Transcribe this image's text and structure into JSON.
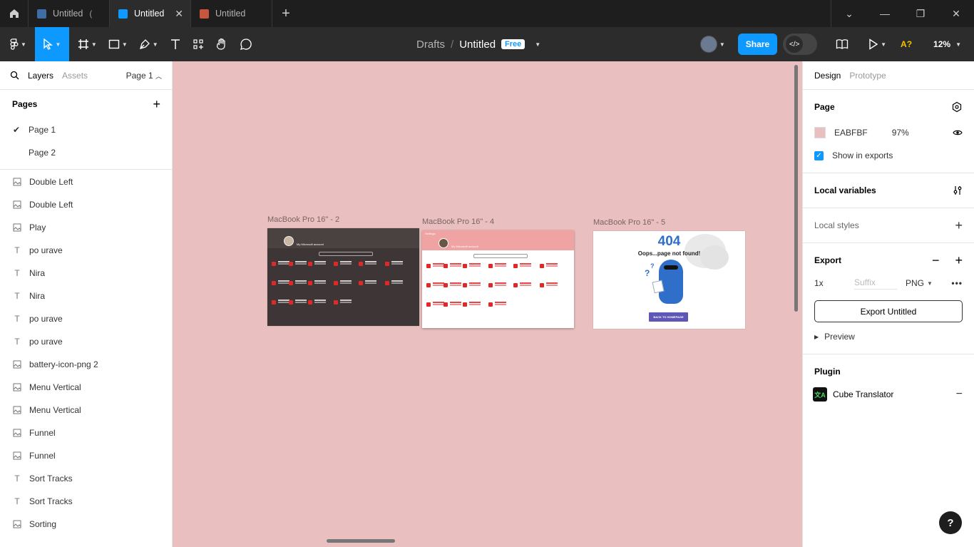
{
  "tabs": [
    {
      "label": "Untitled",
      "active": false,
      "icon_color": "#3d6fa6"
    },
    {
      "label": "Untitled",
      "active": true,
      "icon_color": "#0d99ff"
    },
    {
      "label": "Untitled",
      "active": false,
      "icon_color": "#c8553d"
    }
  ],
  "toolbar": {
    "breadcrumb_drafts": "Drafts",
    "breadcrumb_sep": "/",
    "file_name": "Untitled",
    "plan_badge": "Free",
    "share_label": "Share",
    "font_check": "A?",
    "zoom": "12%"
  },
  "left_panel": {
    "tab_layers": "Layers",
    "tab_assets": "Assets",
    "page_selector": "Page 1",
    "pages_title": "Pages",
    "pages": [
      {
        "label": "Page 1",
        "current": true
      },
      {
        "label": "Page 2",
        "current": false
      }
    ],
    "layers": [
      {
        "label": "Double Left",
        "kind": "image"
      },
      {
        "label": "Double Left",
        "kind": "image"
      },
      {
        "label": "Play",
        "kind": "image"
      },
      {
        "label": "po urave",
        "kind": "text"
      },
      {
        "label": "Nira",
        "kind": "text"
      },
      {
        "label": "Nira",
        "kind": "text"
      },
      {
        "label": "po urave",
        "kind": "text"
      },
      {
        "label": "po urave",
        "kind": "text"
      },
      {
        "label": "battery-icon-png 2",
        "kind": "image"
      },
      {
        "label": "Menu Vertical",
        "kind": "image"
      },
      {
        "label": "Menu Vertical",
        "kind": "image"
      },
      {
        "label": "Funnel",
        "kind": "image"
      },
      {
        "label": "Funnel",
        "kind": "image"
      },
      {
        "label": "Sort Tracks",
        "kind": "text"
      },
      {
        "label": "Sort Tracks",
        "kind": "text"
      },
      {
        "label": "Sorting",
        "kind": "image"
      }
    ]
  },
  "canvas": {
    "background": "#EABFBF",
    "frames": [
      {
        "label": "MacBook Pro 16\" - 2",
        "title": "Settings",
        "theme": "dark",
        "account": "My Microsoft account"
      },
      {
        "label": "MacBook Pro 16\" - 4",
        "title": "Settings",
        "theme": "light",
        "account": "My Microsoft account"
      },
      {
        "label": "MacBook Pro 16\" - 5",
        "code": "404",
        "message": "Oops...page not found!",
        "button": "BACK TO HOMEPAGE"
      }
    ]
  },
  "right_panel": {
    "tab_design": "Design",
    "tab_prototype": "Prototype",
    "page_title": "Page",
    "page_color": "EABFBF",
    "page_opacity": "97%",
    "show_in_exports": "Show in exports",
    "local_variables": "Local variables",
    "local_styles": "Local styles",
    "export_title": "Export",
    "export_scale": "1x",
    "export_suffix_placeholder": "Suffix",
    "export_format": "PNG",
    "export_button": "Export Untitled",
    "preview": "Preview",
    "plugin_title": "Plugin",
    "plugin_name": "Cube Translator",
    "help": "?"
  }
}
